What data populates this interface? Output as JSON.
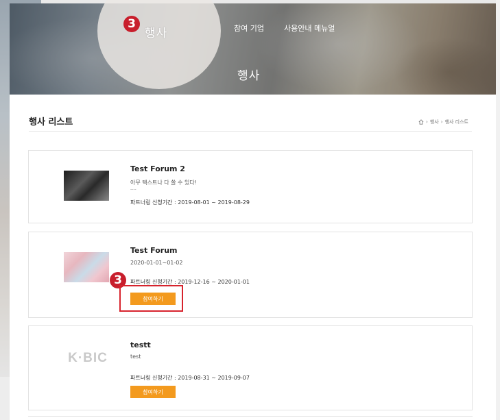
{
  "hero": {
    "circle_label": "행사",
    "badge_number": "3",
    "nav": [
      "참여 기업",
      "사용안내 메뉴얼"
    ],
    "title": "행사"
  },
  "page": {
    "heading": "행사 리스트",
    "breadcrumb": [
      "행사",
      "행사 리스트"
    ]
  },
  "events": [
    {
      "title": "Test Forum 2",
      "description": "아무 텍스트나 다 쓸 수 있다!",
      "dash": "----",
      "period": "파트너링 신청기간 : 2019-08-01 ~ 2019-08-29"
    },
    {
      "title": "Test Forum",
      "description": "2020-01-01~01-02",
      "period": "파트너링 신청기간 : 2019-12-16 ~ 2020-01-01",
      "button": "참여하기"
    },
    {
      "title": "testt",
      "logo": "K·BIC",
      "description": "test",
      "period": "파트너링 신청기간 : 2019-08-31 ~ 2019-09-07",
      "button": "참여하기"
    }
  ],
  "annotation": {
    "badge_number": "3",
    "box_color": "#d7232d"
  },
  "colors": {
    "button": "#f39a1e",
    "badge": "#c81e2c"
  }
}
